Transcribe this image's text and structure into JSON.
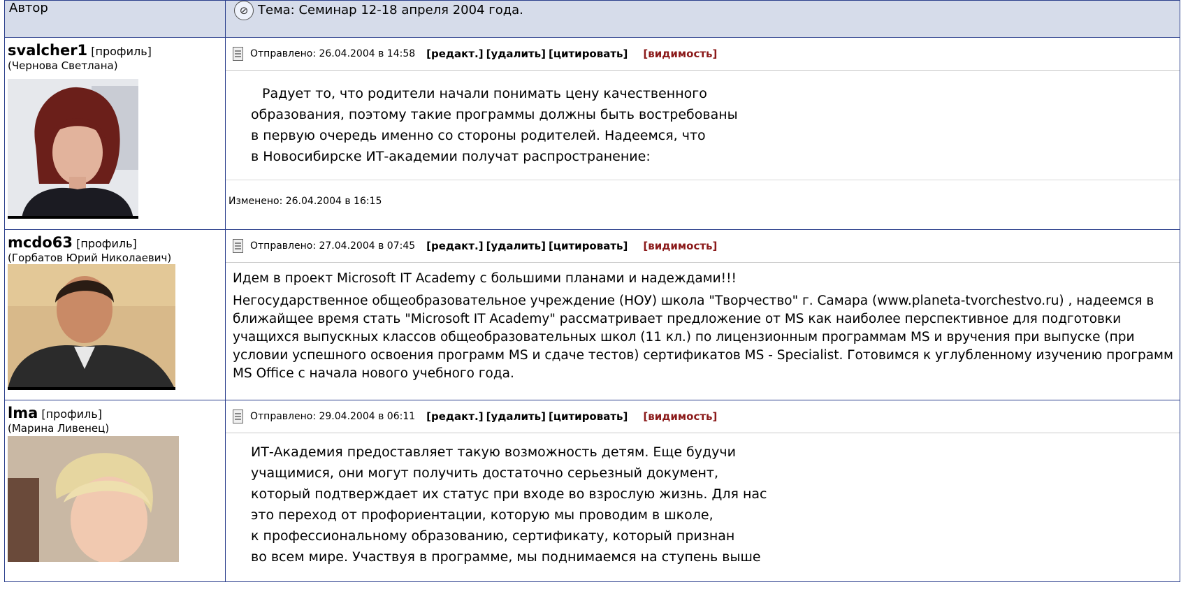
{
  "header": {
    "author_col": "Автор",
    "topic": "Тема: Семинар 12-18 апреля 2004 года."
  },
  "actions": {
    "edit": "[редакт.]",
    "delete": "[удалить]",
    "quote": "[цитировать]",
    "visibility": "[видимость]"
  },
  "posts": [
    {
      "username": "svalcher1",
      "profile": "[профиль]",
      "realname": "(Чернова Светлана)",
      "sent": "Отправлено: 26.04.2004 в 14:58",
      "lines": [
        "Радует то, что родители начали понимать цену качественного",
        "образования, поэтому такие программы должны быть востребованы",
        "в первую очередь именно со стороны родителей. Надеемся, что",
        "в Новосибирске ИТ-академии получат распространение:"
      ],
      "edited": "Изменено: 26.04.2004 в 16:15"
    },
    {
      "username": "mcdo63",
      "profile": "[профиль]",
      "realname": "(Горбатов Юрий Николаевич)",
      "sent": "Отправлено: 27.04.2004 в 07:45",
      "para1": "Идем в проект Microsoft IT Academy с большими планами и надеждами!!!",
      "para2": "Негосударственное общеобразовательное учреждение (НОУ) школа \"Творчество\" г. Самара (www.planeta-tvorchestvo.ru) , надеемся в ближайщее время стать \"Microsoft IT Academy\" рассматривает предложение от MS как наиболее перспективное для подготовки учащихся выпускных классов общеобразовательных школ (11 кл.) по лицензионным программам MS и вручения при выпуске (при условии успешного освоения программ MS и сдаче тестов) сертификатов MS - Specialist. Готовимся к углубленному изучению программ MS Office с начала нового учебного года."
    },
    {
      "username": "lma",
      "profile": "[профиль]",
      "realname": "(Марина Ливенец)",
      "sent": "Отправлено: 29.04.2004 в 06:11",
      "lines": [
        "ИТ-Академия предоставляет такую возможность детям. Еще будучи",
        "учащимися, они могут получить достаточно серьезный документ,",
        "который подтверждает их статус при входе во взрослую жизнь. Для нас",
        "это переход от профориентации, которую мы проводим в школе,",
        "к профессиональному образованию, сертификату, который признан",
        "во всем мире. Участвуя в программе, мы поднимаемся на ступень выше"
      ]
    }
  ]
}
